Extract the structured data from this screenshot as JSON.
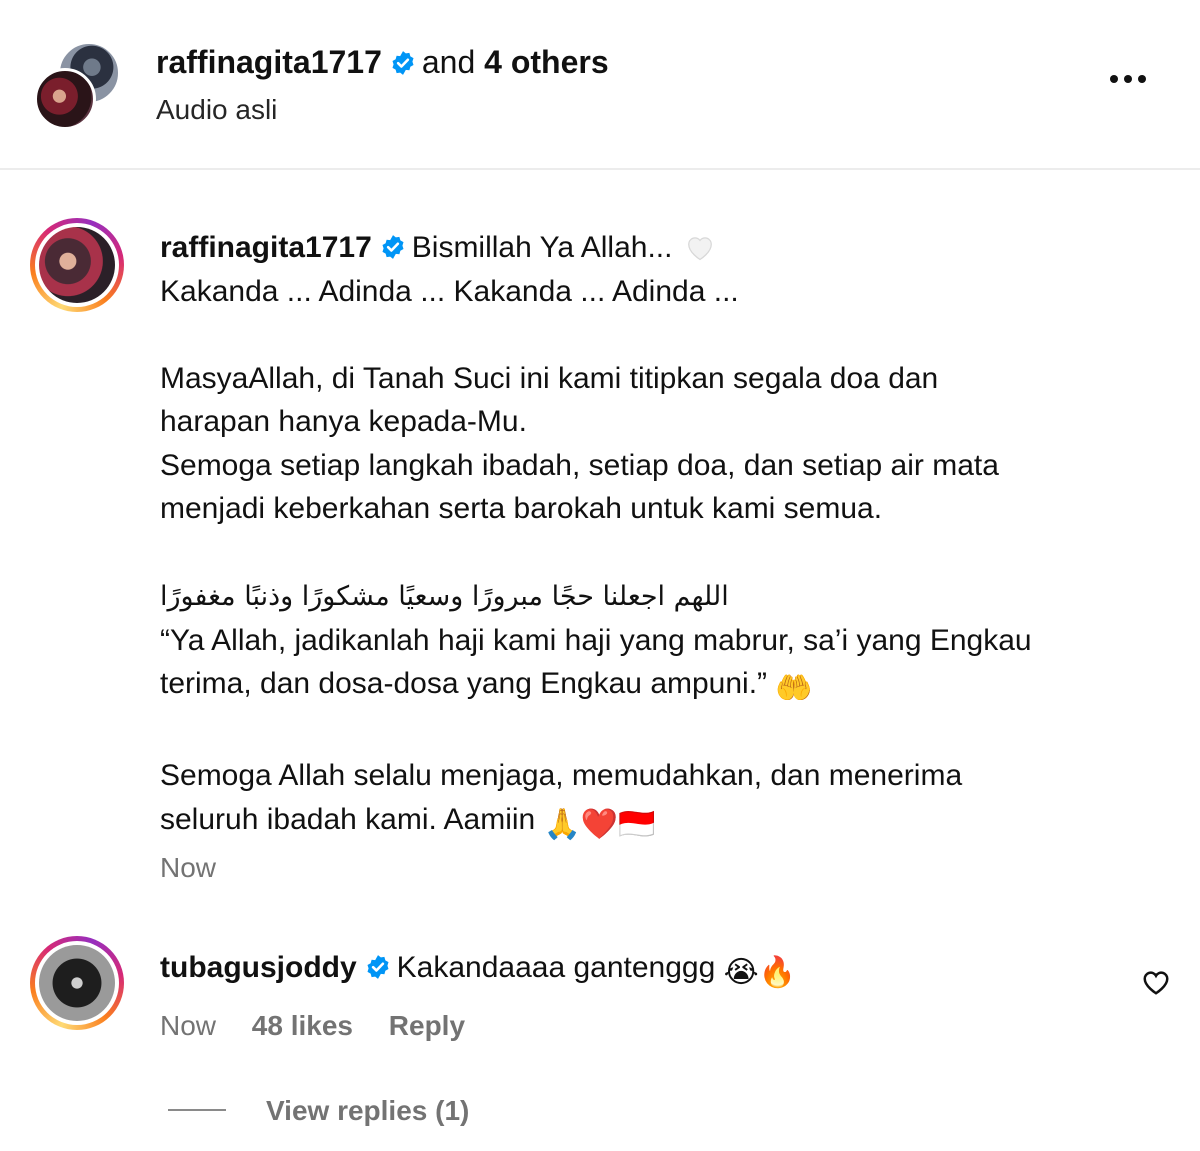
{
  "header": {
    "username": "raffinagita1717",
    "and_text": "and",
    "others": "4 others",
    "audio": "Audio asli"
  },
  "comments": [
    {
      "username": "raffinagita1717",
      "lines": [
        "Bismillah Ya Allah... ",
        "Kakanda ... Adinda ... Kakanda ... Adinda ...",
        "",
        "MasyaAllah, di Tanah Suci ini kami titipkan segala doa dan",
        "harapan hanya kepada-Mu.",
        "Semoga setiap langkah ibadah, setiap doa, dan setiap air mata",
        "menjadi keberkahan serta barokah untuk kami semua.",
        "",
        "اللهم اجعلنا حجًا مبرورًا وسعيًا مشكورًا وذنبًا مغفورًا",
        "“Ya Allah, jadikanlah haji kami haji yang mabrur, sa’i yang Engkau",
        "terima, dan dosa-dosa yang Engkau ampuni.” ",
        "",
        "Semoga Allah selalu menjaga, memudahkan, dan menerima",
        "seluruh ibadah kami. Aamiin "
      ],
      "emoji_palms": "🤲",
      "emoji_end": "🙏❤️🇮🇩",
      "time": "Now"
    },
    {
      "username": "tubagusjoddy",
      "text": "Kakandaaaa ganteng gg",
      "text_exact": "Kakandaaaa gantenggg ",
      "emoji": "😭🔥",
      "time": "Now",
      "likes": "48 likes",
      "reply": "Reply",
      "view_replies": "View replies (1)"
    }
  ],
  "colors": {
    "verified": "#0095f6",
    "meta": "#737373"
  }
}
